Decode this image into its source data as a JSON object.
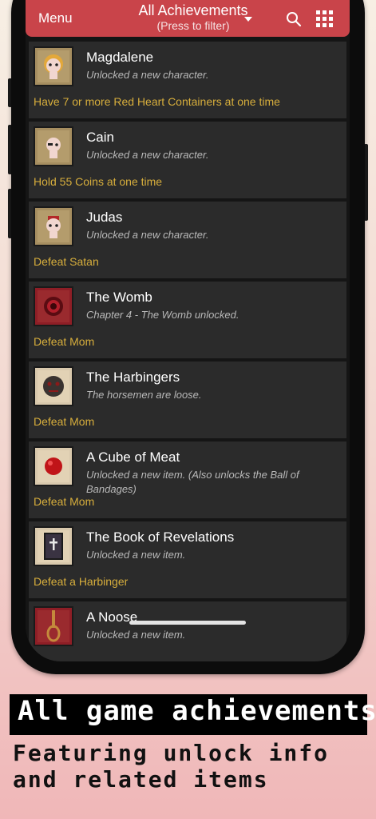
{
  "nav": {
    "menu_label": "Menu",
    "filter_title": "All Achievements",
    "filter_subtitle": "(Press to filter)",
    "search_icon": "search-icon",
    "grid_icon": "grid-icon"
  },
  "achievements": [
    {
      "name": "Magdalene",
      "description": "Unlocked a new character.",
      "requirement": "Have 7 or more Red Heart Containers at one time",
      "icon": "magdalene-icon"
    },
    {
      "name": "Cain",
      "description": "Unlocked a new character.",
      "requirement": "Hold 55 Coins at one time",
      "icon": "cain-icon"
    },
    {
      "name": "Judas",
      "description": "Unlocked a new character.",
      "requirement": "Defeat Satan",
      "icon": "judas-icon"
    },
    {
      "name": "The Womb",
      "description": "Chapter 4 - The Womb unlocked.",
      "requirement": "Defeat Mom",
      "icon": "womb-icon"
    },
    {
      "name": "The Harbingers",
      "description": "The horsemen are loose.",
      "requirement": "Defeat Mom",
      "icon": "harbingers-icon"
    },
    {
      "name": "A Cube of Meat",
      "description": "Unlocked a new item. (Also unlocks the Ball of Bandages)",
      "requirement": "Defeat Mom",
      "icon": "cube-of-meat-icon"
    },
    {
      "name": "The Book of Revelations",
      "description": "Unlocked a new item.",
      "requirement": "Defeat a Harbinger",
      "icon": "book-of-revelations-icon"
    },
    {
      "name": "A Noose",
      "description": "Unlocked a new item.",
      "requirement": "",
      "icon": "noose-icon"
    }
  ],
  "captions": {
    "headline": "All game achievements",
    "subline": "Featuring unlock info and related items"
  },
  "colors": {
    "nav_bar": "#c9444a",
    "card_bg": "#2b2b2b",
    "requirement_text": "#d7ae3c",
    "description_text": "#b9b9b9"
  }
}
